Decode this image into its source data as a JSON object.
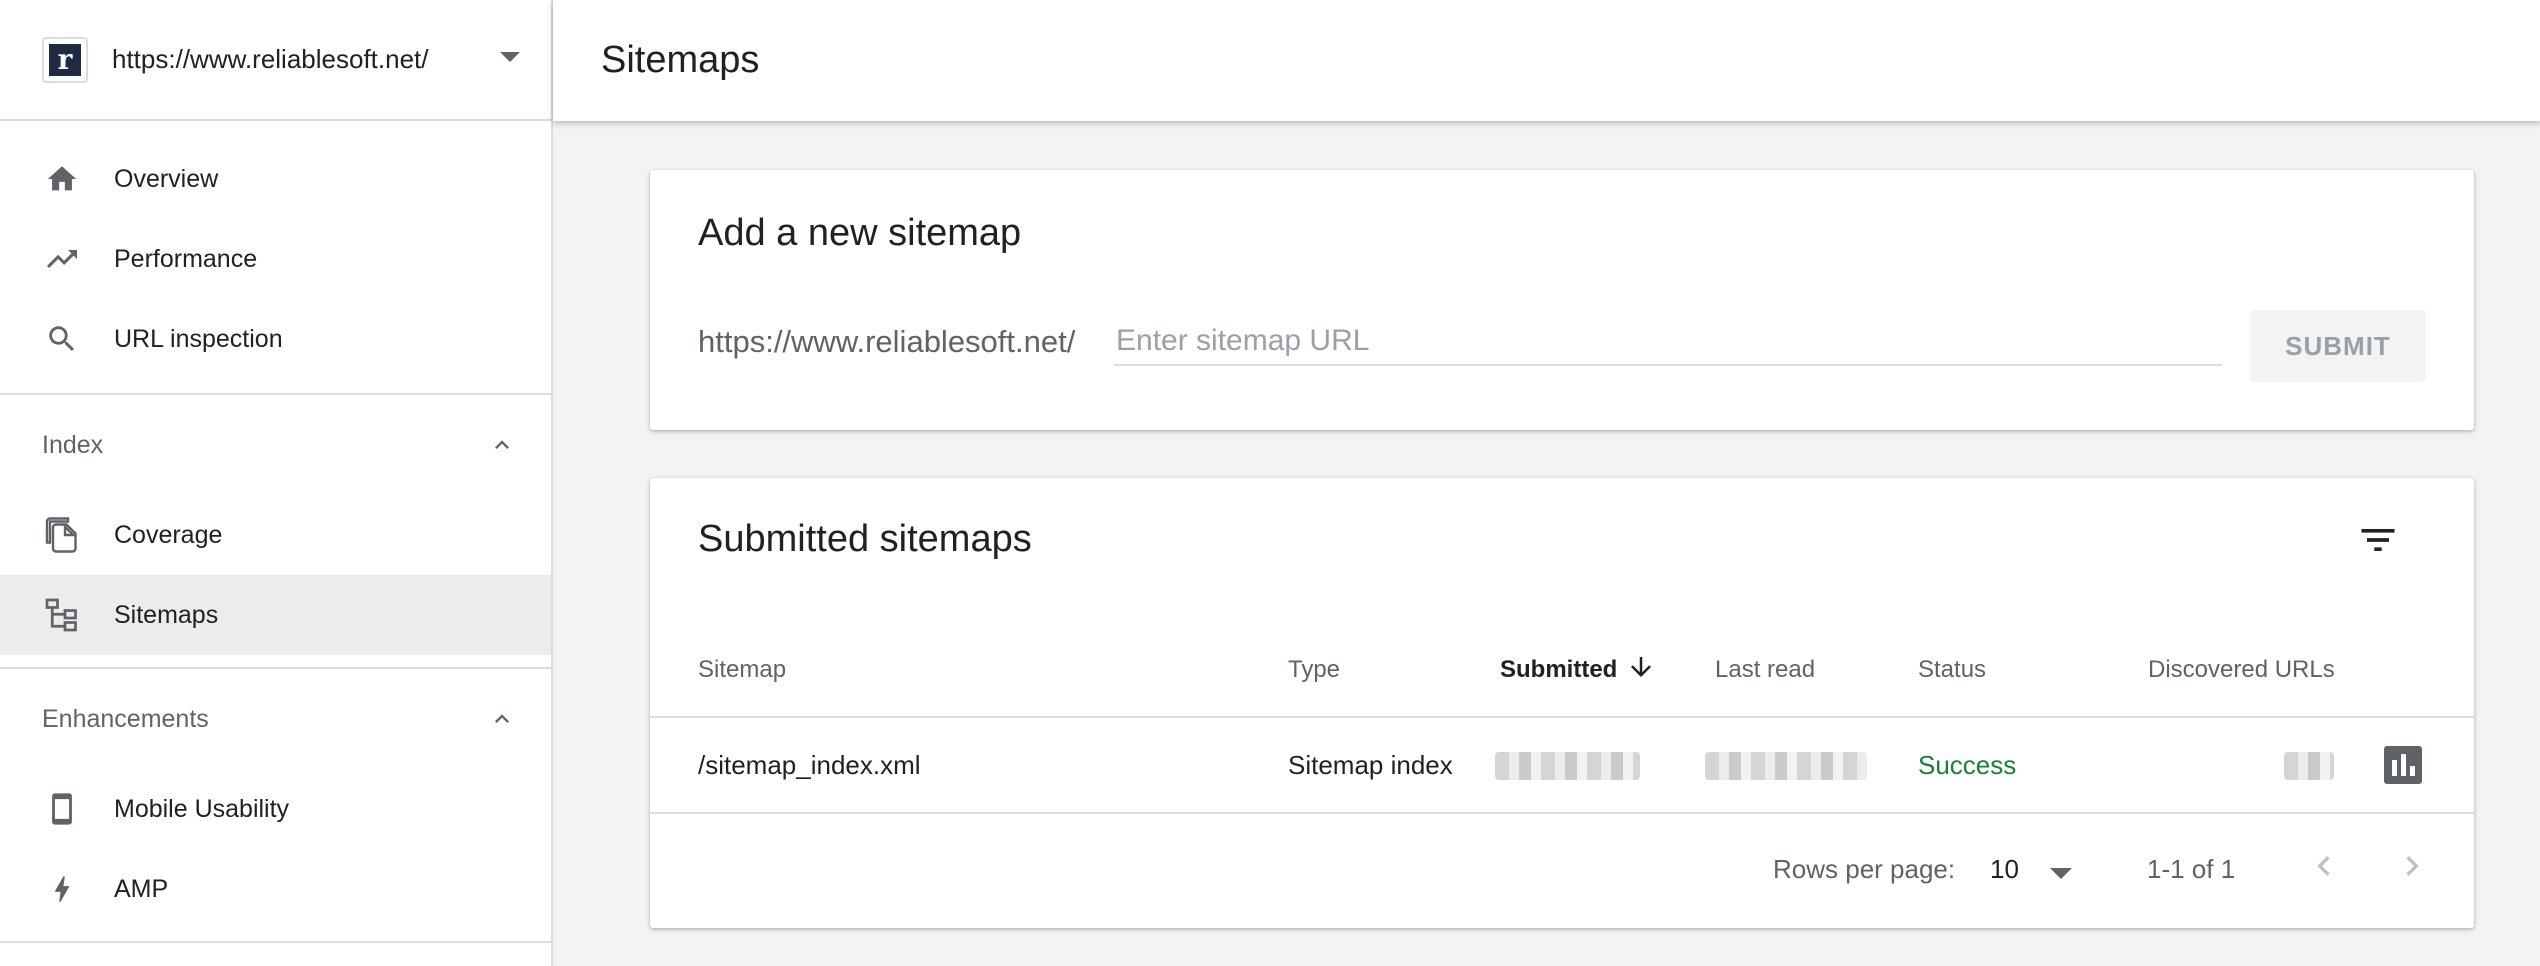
{
  "sidebar": {
    "property_url": "https://www.reliablesoft.net/",
    "logo_letter": "r",
    "nav_top": [
      {
        "label": "Overview",
        "icon": "home-icon"
      },
      {
        "label": "Performance",
        "icon": "trending-up-icon"
      },
      {
        "label": "URL inspection",
        "icon": "search-icon"
      }
    ],
    "index_section": {
      "title": "Index",
      "items": [
        {
          "label": "Coverage",
          "icon": "copy-pages-icon"
        },
        {
          "label": "Sitemaps",
          "icon": "sitemap-tree-icon",
          "active": true
        }
      ]
    },
    "enhancements_section": {
      "title": "Enhancements",
      "items": [
        {
          "label": "Mobile Usability",
          "icon": "smartphone-icon"
        },
        {
          "label": "AMP",
          "icon": "bolt-icon"
        }
      ]
    }
  },
  "header": {
    "title": "Sitemaps"
  },
  "add_sitemap": {
    "title": "Add a new sitemap",
    "prefix": "https://www.reliablesoft.net/",
    "placeholder": "Enter sitemap URL",
    "submit_label": "SUBMIT"
  },
  "submitted": {
    "title": "Submitted sitemaps",
    "columns": {
      "sitemap": "Sitemap",
      "type": "Type",
      "submitted": "Submitted",
      "last_read": "Last read",
      "status": "Status",
      "discovered": "Discovered URLs"
    },
    "rows": [
      {
        "sitemap": "/sitemap_index.xml",
        "type": "Sitemap index",
        "status": "Success"
      }
    ],
    "pagination": {
      "rows_per_page_label": "Rows per page:",
      "rows_per_page": "10",
      "range": "1-1 of 1"
    }
  },
  "colors": {
    "accent": "#188038",
    "active_bg": "#ececec",
    "icon": "#5f6368"
  }
}
